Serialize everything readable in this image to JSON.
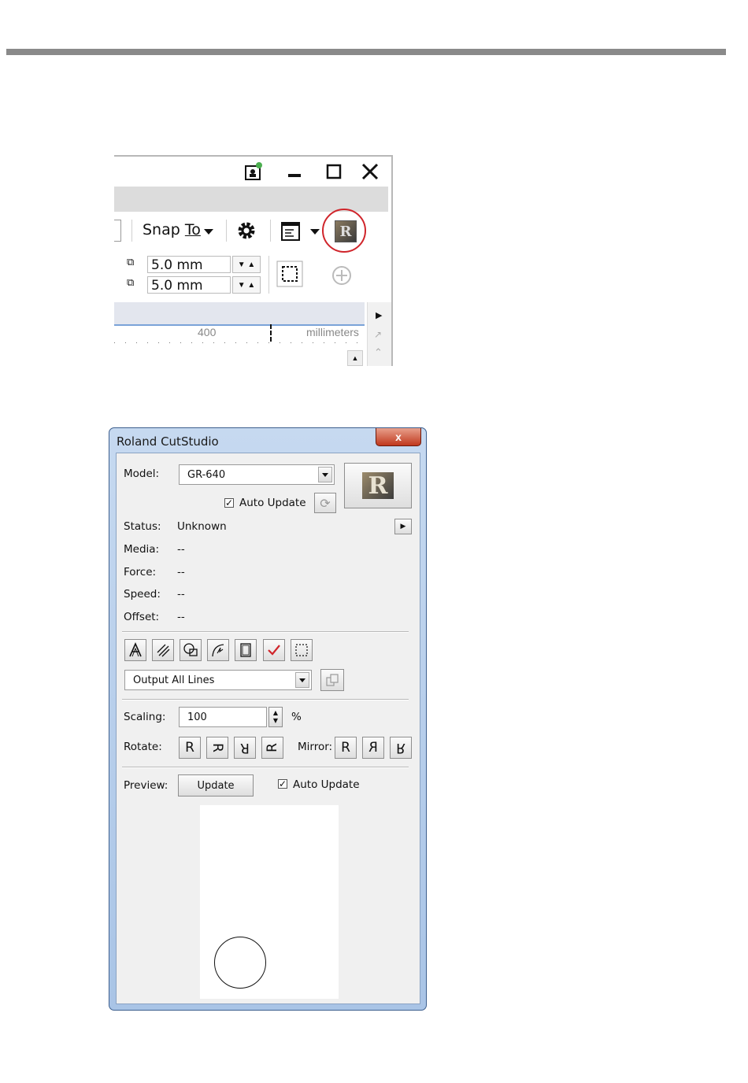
{
  "toolbar": {
    "snap_to_prefix": "Snap ",
    "snap_to_underlined": "To",
    "nudge_x": "5.0 mm",
    "nudge_y": "5.0 mm",
    "ruler_tick": "400",
    "ruler_unit": "millimeters",
    "highlight_color": "#d0252b"
  },
  "cutstudio": {
    "title": "Roland CutStudio",
    "close_glyph": "x",
    "model_label": "Model:",
    "model_value": "GR-640",
    "auto_update_label": "Auto Update",
    "auto_update_checked": true,
    "status_rows": [
      {
        "label": "Status:",
        "value": "Unknown"
      },
      {
        "label": "Media:",
        "value": "--"
      },
      {
        "label": "Force:",
        "value": "--"
      },
      {
        "label": "Speed:",
        "value": "--"
      },
      {
        "label": "Offset:",
        "value": "--"
      }
    ],
    "tool_icons": [
      "font-outline-icon",
      "hatch-icon",
      "shapes-icon",
      "curve-icon",
      "frame-icon",
      "check-icon",
      "selection-icon"
    ],
    "output_value": "Output All Lines",
    "scaling_label": "Scaling:",
    "scaling_value": "100",
    "scaling_unit": "%",
    "rotate_label": "Rotate:",
    "rotate_glyphs": [
      "R",
      "ʁ",
      "ꓤ",
      "ʁ"
    ],
    "mirror_label": "Mirror:",
    "mirror_glyphs": [
      "R",
      "Я",
      "ꓤ"
    ],
    "preview_label": "Preview:",
    "update_button": "Update",
    "preview_auto_update": "Auto Update",
    "preview_auto_update_checked": true
  }
}
